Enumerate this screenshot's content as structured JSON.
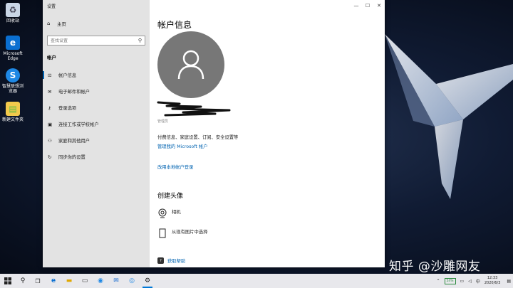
{
  "desktop": {
    "icons": [
      {
        "name": "recycle-bin",
        "label": "回收站"
      },
      {
        "name": "microsoft-edge",
        "label": "Microsoft Edge"
      },
      {
        "name": "app-shortcut",
        "label": "智慧联想浏览器"
      },
      {
        "name": "new-folder",
        "label": "新建文件夹"
      }
    ]
  },
  "window": {
    "title": "设置",
    "controls": {
      "minimize": "—",
      "maximize": "☐",
      "close": "✕"
    }
  },
  "sidebar": {
    "home_label": "主页",
    "search_placeholder": "查找设置",
    "section_label": "帐户",
    "items": [
      {
        "label": "帐户信息",
        "icon": "person-card-icon",
        "active": true
      },
      {
        "label": "电子邮件和帐户",
        "icon": "mail-icon",
        "active": false
      },
      {
        "label": "登录选项",
        "icon": "key-icon",
        "active": false
      },
      {
        "label": "连接工作或学校帐户",
        "icon": "briefcase-icon",
        "active": false
      },
      {
        "label": "家庭和其他用户",
        "icon": "people-icon",
        "active": false
      },
      {
        "label": "同步你的设置",
        "icon": "sync-icon",
        "active": false
      }
    ]
  },
  "content": {
    "title": "帐户信息",
    "account_subtext": "管理员",
    "account_description": "付费信息、家庭设置、订阅、安全设置等",
    "manage_account_link": "管理我的 Microsoft 帐户",
    "local_account_link": "改用本地帐户登录",
    "create_avatar_title": "创建头像",
    "options": [
      {
        "label": "相机",
        "icon": "camera-icon"
      },
      {
        "label": "从现有图片中选择",
        "icon": "picture-icon"
      }
    ],
    "help_label": "获取帮助"
  },
  "watermark": "知乎 @沙雕网友",
  "taskbar": {
    "battery": "54%",
    "ime": "中",
    "time": "12:33",
    "date": "2020/6/3"
  },
  "colors": {
    "accent": "#0063b1",
    "sidebar_bg": "#e3e3e3",
    "avatar_bg": "#777777"
  }
}
